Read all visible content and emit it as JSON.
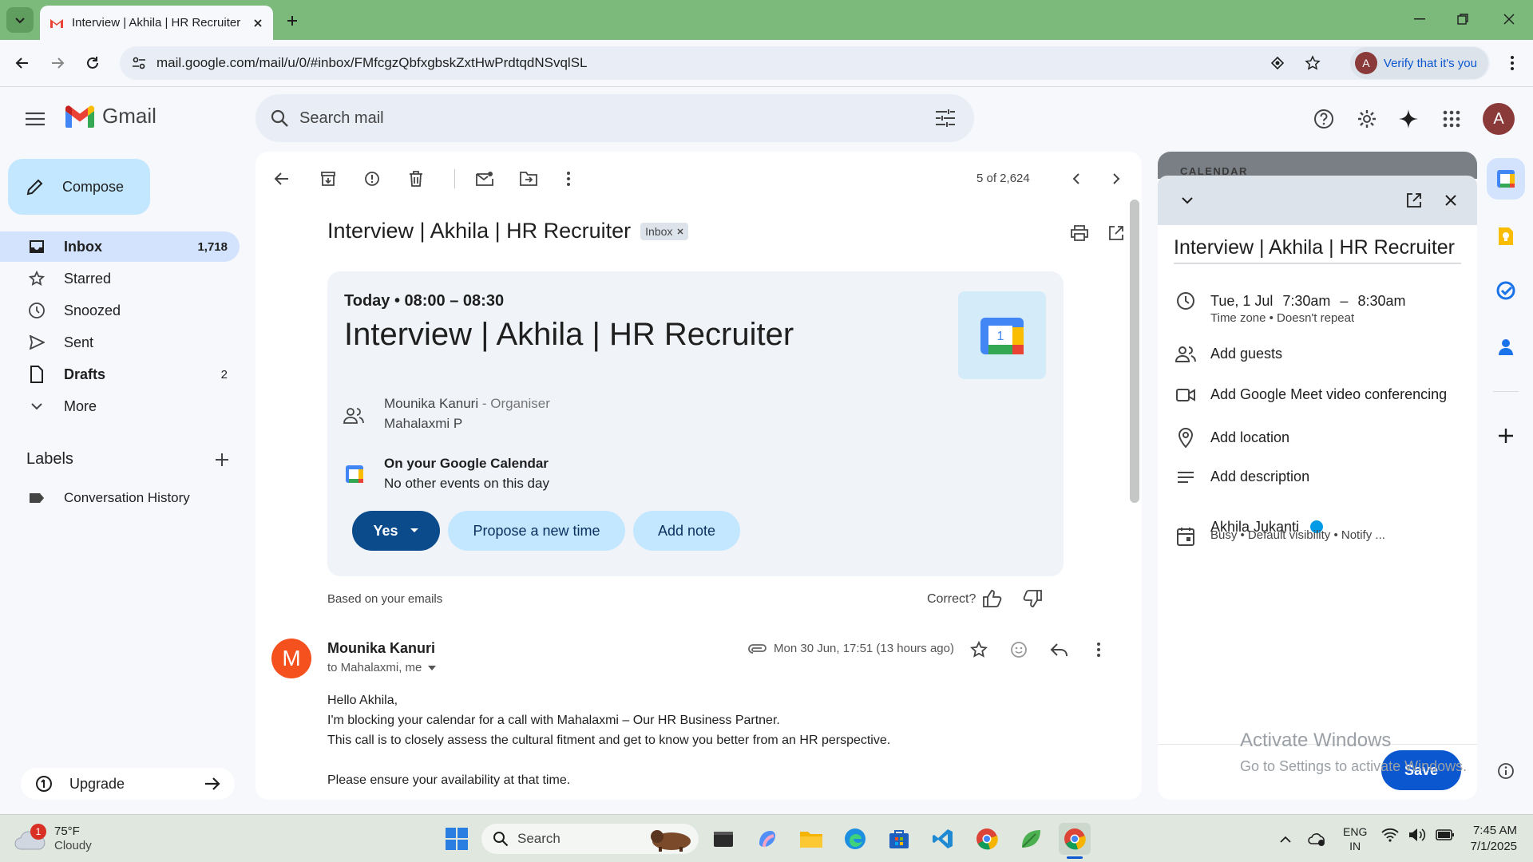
{
  "browser": {
    "tab_title": "Interview | Akhila | HR Recruiter",
    "url": "mail.google.com/mail/u/0/#inbox/FMfcgzQbfxgbskZxtHwPrdtqdNSvqlSL",
    "verify_label": "Verify that it's you",
    "profile_letter": "A"
  },
  "gmail": {
    "brand": "Gmail",
    "search_placeholder": "Search mail",
    "avatar_letter": "A",
    "compose_label": "Compose",
    "nav": [
      {
        "label": "Inbox",
        "count": "1,718"
      },
      {
        "label": "Starred",
        "count": ""
      },
      {
        "label": "Snoozed",
        "count": ""
      },
      {
        "label": "Sent",
        "count": ""
      },
      {
        "label": "Drafts",
        "count": "2"
      },
      {
        "label": "More",
        "count": ""
      }
    ],
    "labels_heading": "Labels",
    "labels": [
      "Conversation History"
    ],
    "upgrade_label": "Upgrade"
  },
  "thread": {
    "pager": "5 of 2,624",
    "subject": "Interview | Akhila | HR Recruiter",
    "chip": "Inbox",
    "event": {
      "when": "Today • 08:00 – 08:30",
      "title": "Interview | Akhila | HR Recruiter",
      "organiser_name": "Mounika Kanuri",
      "organiser_role": " - Organiser",
      "attendee": "Mahalaxmi P",
      "cal_heading": "On your Google Calendar",
      "cal_sub": "No other events on this day",
      "yes_label": "Yes",
      "propose_label": "Propose a new time",
      "note_label": "Add note",
      "cal_icon_day": "1"
    },
    "based_on": "Based on your emails",
    "correct_label": "Correct?",
    "message": {
      "avatar_letter": "M",
      "sender": "Mounika Kanuri",
      "to": "to Mahalaxmi, me",
      "date": "Mon 30 Jun, 17:51 (13 hours ago)",
      "body": [
        "Hello Akhila,",
        "I'm blocking your calendar for a call with Mahalaxmi – Our HR Business Partner.",
        "This call is to closely assess the cultural fitment and get to know you better from an HR perspective.",
        "",
        "Please ensure your availability at that time."
      ]
    }
  },
  "calendar_panel": {
    "header": "CALENDAR",
    "title": "Interview | Akhila | HR Recruiter",
    "date": "Tue, 1 Jul",
    "start": "7:30am",
    "dash": "–",
    "end": "8:30am",
    "time_sub": "Time zone • Doesn't repeat",
    "add_guests": "Add guests",
    "add_meet": "Add Google Meet video conferencing",
    "add_location": "Add location",
    "add_description": "Add description",
    "owner": "Akhila Jukanti",
    "owner_sub": "Busy • Default visibility • Notify ...",
    "save_label": "Save",
    "watermark_title": "Activate Windows",
    "watermark_sub": "Go to Settings to activate Windows."
  },
  "taskbar": {
    "temp": "75°F",
    "weather": "Cloudy",
    "weather_badge": "1",
    "search_label": "Search",
    "lang": "ENG",
    "region": "IN",
    "time": "7:45 AM",
    "date": "7/1/2025"
  },
  "colors": {
    "tabbar": "#7cba7c",
    "accent": "#0b57d0",
    "yes_button": "#0b4a8b",
    "pill": "#c2e7ff",
    "gmail_red": "#ea4335",
    "avatar_profile": "#8b3a3a",
    "avatar_sender": "#f4511e"
  }
}
